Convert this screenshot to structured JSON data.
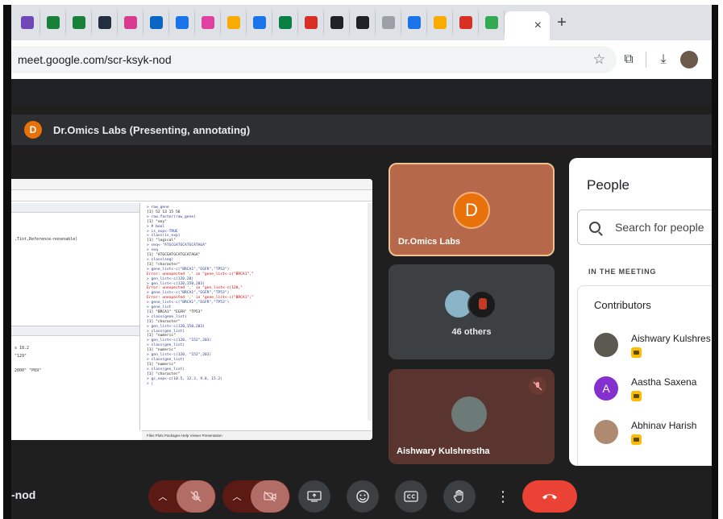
{
  "browser": {
    "tabs": [
      {
        "icon": "form-icon",
        "color": "#7248b9"
      },
      {
        "icon": "sheets-icon",
        "color": "#188038"
      },
      {
        "icon": "sheets-icon",
        "color": "#188038"
      },
      {
        "icon": "amazon-icon",
        "color": "#232f3e"
      },
      {
        "icon": "app-icon",
        "color": "#d93c8e"
      },
      {
        "icon": "linkedin-icon",
        "color": "#0a66c2"
      },
      {
        "icon": "app-icon",
        "color": "#1a73e8"
      },
      {
        "icon": "app-icon",
        "color": "#e040a0"
      },
      {
        "icon": "app-icon",
        "color": "#f9ab00"
      },
      {
        "icon": "app-icon",
        "color": "#1a73e8"
      },
      {
        "icon": "app-icon",
        "color": "#0b8043"
      },
      {
        "icon": "app-icon",
        "color": "#d93025"
      },
      {
        "icon": "app-icon",
        "color": "#202124"
      },
      {
        "icon": "app-icon",
        "color": "#202124"
      },
      {
        "icon": "app-icon",
        "color": "#9aa0a6"
      },
      {
        "icon": "app-icon",
        "color": "#1a73e8"
      },
      {
        "icon": "app-icon",
        "color": "#f9ab00"
      },
      {
        "icon": "app-icon",
        "color": "#d93025"
      },
      {
        "icon": "app-icon",
        "color": "#34a853"
      }
    ],
    "active_tab_close": "×",
    "new_tab": "+",
    "url": "meet.google.com/scr-ksyk-nod"
  },
  "meeting": {
    "presenter_initial": "D",
    "presenter_banner": "Dr.Omics Labs (Presenting, annotating)",
    "tiles": {
      "presenter_name": "Dr.Omics Labs",
      "presenter_initial": "D",
      "others_label": "46 others",
      "aishwary_name": "Aishwary Kulshrestha"
    },
    "meet_code": "-nod"
  },
  "screen_share": {
    "left_lines": [
      ",Tint,Reference-nonenable)",
      "s 18.2",
      "\"129\"",
      "2000\" \"P69\""
    ],
    "console": [
      {
        "t": "> raw_gene",
        "k": "cmd"
      },
      {
        "t": "[1] 52 13 15 56",
        "k": ""
      },
      {
        "t": "> raw.factor(raw_gene)",
        "k": "cmd"
      },
      {
        "t": "[1] \"any\"",
        "k": ""
      },
      {
        "t": "> # bool",
        "k": "cmd"
      },
      {
        "t": "> is_exp<-TRUE",
        "k": "cmd"
      },
      {
        "t": "> class(is_exp)",
        "k": "cmd"
      },
      {
        "t": "[1] \"logical\"",
        "k": ""
      },
      {
        "t": "> seq<-\"ATGCGATGCATGCATAGA\"",
        "k": "cmd"
      },
      {
        "t": "> seq",
        "k": "cmd"
      },
      {
        "t": "[1] \"ATGCGATGCATGCATAGA\"",
        "k": ""
      },
      {
        "t": "> class(seq)",
        "k": "cmd"
      },
      {
        "t": "[1] \"character\"",
        "k": ""
      },
      {
        "t": "> gene_list<-c(\"BRCA1\",\"EGFR\",\"TP53\")",
        "k": "cmd"
      },
      {
        "t": "Error: unexpected ',' in \"gene_list<-c(\"BRCA1\",\"",
        "k": "err"
      },
      {
        "t": "> gen_list<-c(120,20)",
        "k": "cmd"
      },
      {
        "t": "> gen_list<-c(120,150,203)",
        "k": "cmd"
      },
      {
        "t": "Error: unexpected ',' in \"gen_list<-c(120,\"",
        "k": "err"
      },
      {
        "t": "> gene_list<-c(\"BRCA1\",\"EGFR\",\"TP53\")",
        "k": "cmd"
      },
      {
        "t": "Error: unexpected ',' in \"gene_list<-c(\"BRCA1\",\"",
        "k": "err"
      },
      {
        "t": "> gene_list<-c(\"BRCA1\",\"EGFR\",\"TP53\")",
        "k": "cmd"
      },
      {
        "t": "> gene_list",
        "k": "cmd"
      },
      {
        "t": "[1] \"BRCA1\" \"EGFR\"  \"TP53\"",
        "k": ""
      },
      {
        "t": "> class(gene_list)",
        "k": "cmd"
      },
      {
        "t": "[1] \"character\"",
        "k": ""
      },
      {
        "t": "> gen_list<-c(120,150,203)",
        "k": "cmd"
      },
      {
        "t": "> class(gen_list)",
        "k": "cmd"
      },
      {
        "t": "[1] \"numeric\"",
        "k": ""
      },
      {
        "t": "> gen_list<-c(120, \"152\",203)",
        "k": "cmd"
      },
      {
        "t": "> class(gen_list)",
        "k": "cmd"
      },
      {
        "t": "[1] \"numeric\"",
        "k": ""
      },
      {
        "t": "> gen_list<-c(120, \"152\",203)",
        "k": "cmd"
      },
      {
        "t": "> class(gen_list)",
        "k": "cmd"
      },
      {
        "t": "[1] \"numeric\"",
        "k": ""
      },
      {
        "t": "> class(gen_list)",
        "k": "cmd"
      },
      {
        "t": "[1] \"character\"",
        "k": ""
      },
      {
        "t": "> gc_exp<-c(10.5, 12.3, 9.8, 15.2)",
        "k": "cmd"
      },
      {
        "t": "> |",
        "k": "cmd"
      }
    ],
    "bottom_tabs": "Files   Plots   Packages   Help   Viewer   Presentation"
  },
  "people_panel": {
    "title": "People",
    "search_placeholder": "Search for people",
    "section_label": "IN THE MEETING",
    "group_label": "Contributors",
    "people": [
      {
        "name": "Aishwary Kulshres",
        "initial": "",
        "color": "#5a5a50"
      },
      {
        "name": "Aastha Saxena",
        "initial": "A",
        "color": "#8430ce"
      },
      {
        "name": "Abhinav Harish",
        "initial": "",
        "color": "#b08a70"
      }
    ]
  },
  "colors": {
    "accent": "#e8710a",
    "end_call": "#ea4335",
    "mic_off": "#5c1a15"
  }
}
